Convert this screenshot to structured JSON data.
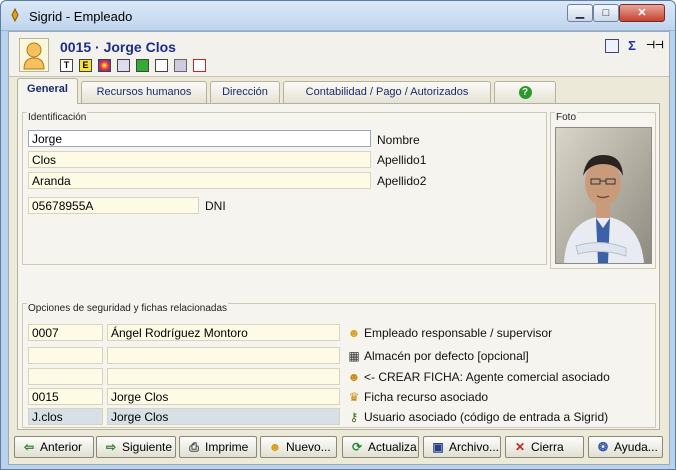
{
  "window": {
    "title": "Sigrid - Empleado",
    "minimize": "▁",
    "maximize": "□",
    "close": "✕"
  },
  "header": {
    "record_title": "0015 · Jorge Clos",
    "tools": [
      "T",
      "E",
      "",
      "",
      "",
      "",
      "",
      ""
    ],
    "right_icons": [
      "list-icon",
      "sigma-icon",
      "pin-icon"
    ],
    "sigma": "Σ",
    "pin": "⊣⊣"
  },
  "tabs": [
    {
      "label": "General",
      "active": true
    },
    {
      "label": "Recursos humanos"
    },
    {
      "label": "Dirección"
    },
    {
      "label": "Contabilidad / Pago / Autorizados"
    },
    {
      "label": "?"
    }
  ],
  "identificacion": {
    "legend": "Identificación",
    "nombre": {
      "value": "Jorge",
      "label": "Nombre"
    },
    "apellido1": {
      "value": "Clos",
      "label": "Apellido1"
    },
    "apellido2": {
      "value": "Aranda",
      "label": "Apellido2"
    },
    "dni": {
      "value": "05678955A",
      "label": "DNI"
    }
  },
  "foto": {
    "legend": "Foto"
  },
  "opciones": {
    "legend": "Opciones de seguridad y fichas relacionadas",
    "rows": [
      {
        "code": "0007",
        "name": "Ángel Rodríguez Montoro",
        "label": "Empleado responsable / supervisor",
        "icon": "person-icon"
      },
      {
        "code": "",
        "name": "",
        "label": "Almacén por defecto [opcional]",
        "icon": "warehouse-icon"
      },
      {
        "code": "",
        "name": "",
        "label": "<- CREAR FICHA: Agente comercial asociado",
        "icon": "agent-icon"
      },
      {
        "code": "0015",
        "name": "Jorge Clos",
        "label": "Ficha recurso asociado",
        "icon": "resource-icon"
      },
      {
        "code": "J.clos",
        "name": "Jorge Clos",
        "label": "Usuario asociado (código de entrada a Sigrid)",
        "icon": "user-key-icon"
      }
    ]
  },
  "buttons": [
    {
      "label": "Anterior",
      "icon": "arrow-left-icon",
      "glyph": "⇦",
      "color": "#2a7d2a"
    },
    {
      "label": "Siguiente",
      "icon": "arrow-right-icon",
      "glyph": "⇨",
      "color": "#2a7d2a"
    },
    {
      "label": "Imprime",
      "icon": "printer-icon",
      "glyph": "⎙",
      "color": "#444444"
    },
    {
      "label": "Nuevo...",
      "icon": "new-user-icon",
      "glyph": "☻",
      "color": "#d79b10"
    },
    {
      "label": "Actualiza",
      "icon": "refresh-icon",
      "glyph": "⟳",
      "color": "#2a8a3a"
    },
    {
      "label": "Archivo...",
      "icon": "save-icon",
      "glyph": "▣",
      "color": "#2a3f8c"
    },
    {
      "label": "Cierra",
      "icon": "close-x-icon",
      "glyph": "✕",
      "color": "#c0281e"
    },
    {
      "label": "Ayuda...",
      "icon": "help-icon",
      "glyph": "❂",
      "color": "#3355aa"
    }
  ]
}
